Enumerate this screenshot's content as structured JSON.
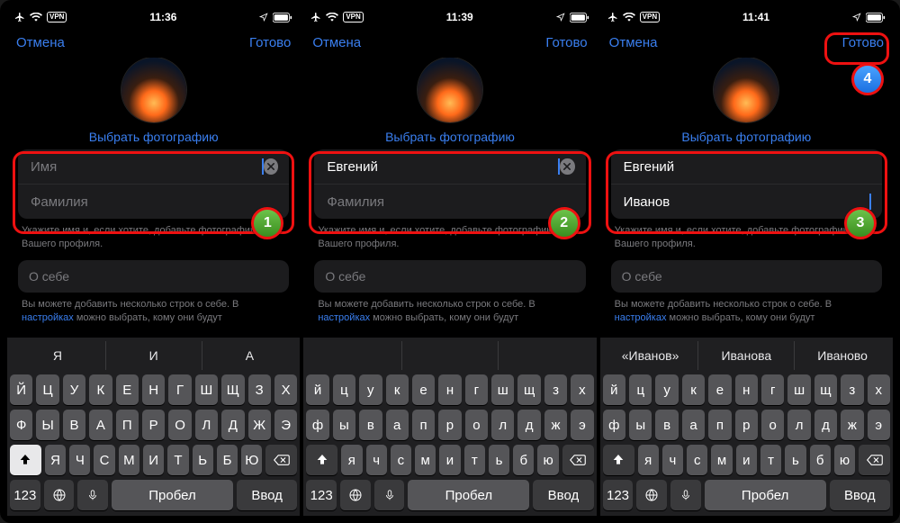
{
  "screens": [
    {
      "time": "11:36",
      "cancel": "Отмена",
      "done": "Готово",
      "choose_photo": "Выбрать фотографию",
      "first_name": {
        "value": "",
        "placeholder": "Имя",
        "focused": true,
        "clear": true
      },
      "last_name": {
        "value": "",
        "placeholder": "Фамилия",
        "focused": false,
        "clear": false
      },
      "hint": "Укажите имя и, если хотите, добавьте фотографию для Вашего профиля.",
      "about_placeholder": "О себе",
      "about_hint_a": "Вы можете добавить несколько строк о себе. В ",
      "about_hint_link": "настройках",
      "about_hint_b": " можно выбрать, кому они будут",
      "keyboard": {
        "case": "upper",
        "shift_on": true,
        "suggestions": [
          "Я",
          "И",
          "А"
        ],
        "quoted": false
      },
      "badge": {
        "num": "1",
        "color": "g"
      },
      "redbox_fields": true,
      "redbox_done": false,
      "badge_offset": "fields"
    },
    {
      "time": "11:39",
      "cancel": "Отмена",
      "done": "Готово",
      "choose_photo": "Выбрать фотографию",
      "first_name": {
        "value": "Евгений",
        "placeholder": "Имя",
        "focused": true,
        "clear": true
      },
      "last_name": {
        "value": "",
        "placeholder": "Фамилия",
        "focused": false,
        "clear": false
      },
      "hint": "Укажите имя и, если хотите, добавьте фотографию для Вашего профиля.",
      "about_placeholder": "О себе",
      "about_hint_a": "Вы можете добавить несколько строк о себе. В ",
      "about_hint_link": "настройках",
      "about_hint_b": " можно выбрать, кому они будут",
      "keyboard": {
        "case": "lower",
        "shift_on": false,
        "suggestions": [
          "",
          "",
          ""
        ],
        "quoted": false
      },
      "badge": {
        "num": "2",
        "color": "g"
      },
      "redbox_fields": true,
      "redbox_done": false,
      "badge_offset": "fields"
    },
    {
      "time": "11:41",
      "cancel": "Отмена",
      "done": "Готово",
      "choose_photo": "Выбрать фотографию",
      "first_name": {
        "value": "Евгений",
        "placeholder": "Имя",
        "focused": false,
        "clear": false
      },
      "last_name": {
        "value": "Иванов",
        "placeholder": "Фамилия",
        "focused": true,
        "clear": false
      },
      "hint": "Укажите имя и, если хотите, добавьте фотографию для Вашего профиля.",
      "about_placeholder": "О себе",
      "about_hint_a": "Вы можете добавить несколько строк о себе. В ",
      "about_hint_link": "настройках",
      "about_hint_b": " можно выбрать, кому они будут",
      "keyboard": {
        "case": "lower",
        "shift_on": false,
        "suggestions": [
          "Иванов",
          "Иванова",
          "Иваново"
        ],
        "quoted": true
      },
      "badge": {
        "num": "3",
        "color": "g"
      },
      "badge2": {
        "num": "4",
        "color": "b"
      },
      "redbox_fields": true,
      "redbox_done": true,
      "badge_offset": "fields"
    }
  ],
  "kbd_rows": {
    "r1": [
      "Й",
      "Ц",
      "У",
      "К",
      "Е",
      "Н",
      "Г",
      "Ш",
      "Щ",
      "З",
      "Х"
    ],
    "r2": [
      "Ф",
      "Ы",
      "В",
      "А",
      "П",
      "Р",
      "О",
      "Л",
      "Д",
      "Ж",
      "Э"
    ],
    "r3": [
      "Я",
      "Ч",
      "С",
      "М",
      "И",
      "Т",
      "Ь",
      "Б",
      "Ю"
    ],
    "bottom": {
      "num": "123",
      "space": "Пробел",
      "ret": "Ввод"
    }
  }
}
